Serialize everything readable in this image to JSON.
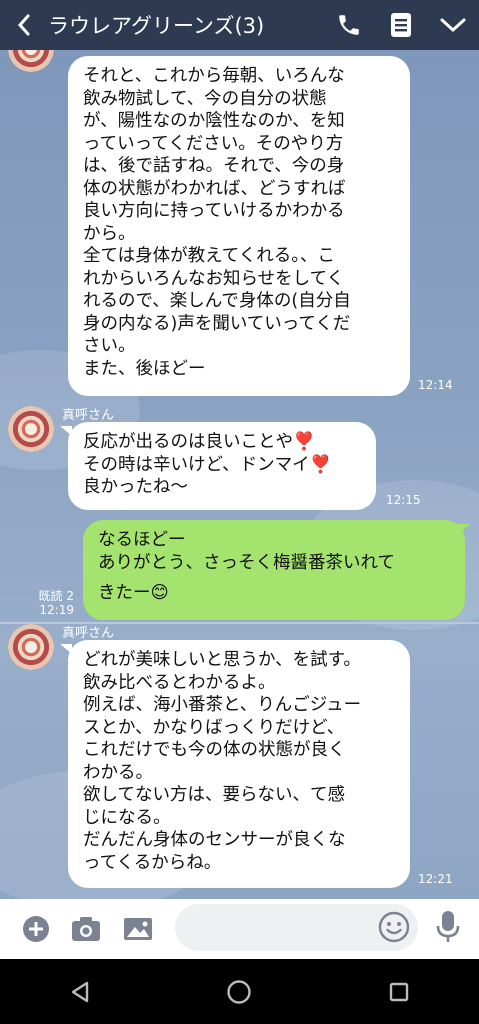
{
  "header": {
    "title": "ラウレアグリーンズ(3)",
    "back_icon": "chevron-left-icon",
    "call_icon": "phone-icon",
    "notes_icon": "notes-icon",
    "menu_icon": "chevron-down-icon"
  },
  "messages": [
    {
      "lines": [
        "それと、これから毎朝、いろんな",
        "飲み物試して、今の自分の状態",
        "が、陽性なのか陰性なのか、を知",
        "っていってください。そのやり方",
        "は、後で話すね。それで、今の身",
        "体の状態がわかれば、どうすれば",
        "良い方向に持っていけるかわかる",
        "から。",
        "全ては身体が教えてくれる。、こ",
        "れからいろんなお知らせをしてく",
        "れるので、楽しんで身体の(自分自",
        "身の内なる)声を聞いていってくだ",
        "さい。",
        "また、後ほどー"
      ],
      "time": "12:14"
    },
    {
      "sender": "真呼さん",
      "lines": [
        "反応が出るのは良いことや❣️",
        "その時は辛いけど、ドンマイ❣️",
        "良かったね〜"
      ],
      "time": "12:15"
    },
    {
      "lines": [
        "なるほどー",
        "ありがとう、さっそく梅醤番茶いれて",
        "きたー😊"
      ],
      "read": "既読 2",
      "time": "12:19"
    },
    {
      "sender": "真呼さん",
      "lines": [
        "どれが美味しいと思うか、を試す。",
        "飲み比べるとわかるよ。",
        "例えば、海小番茶と、りんごジュー",
        "スとか、かなりばっくりだけど、",
        "これだけでも今の体の状態が良く",
        "わかる。",
        "欲してない方は、要らない、て感",
        "じになる。",
        "だんだん身体のセンサーが良くな",
        "ってくるからね。"
      ],
      "time": "12:21"
    }
  ],
  "input": {
    "add_icon": "plus-circle-icon",
    "camera_icon": "camera-icon",
    "image_icon": "image-icon",
    "emoji_icon": "emoji-icon",
    "mic_icon": "microphone-icon"
  },
  "navbar": {
    "back_icon": "nav-back-icon",
    "home_icon": "nav-home-icon",
    "recents_icon": "nav-recents-icon"
  }
}
